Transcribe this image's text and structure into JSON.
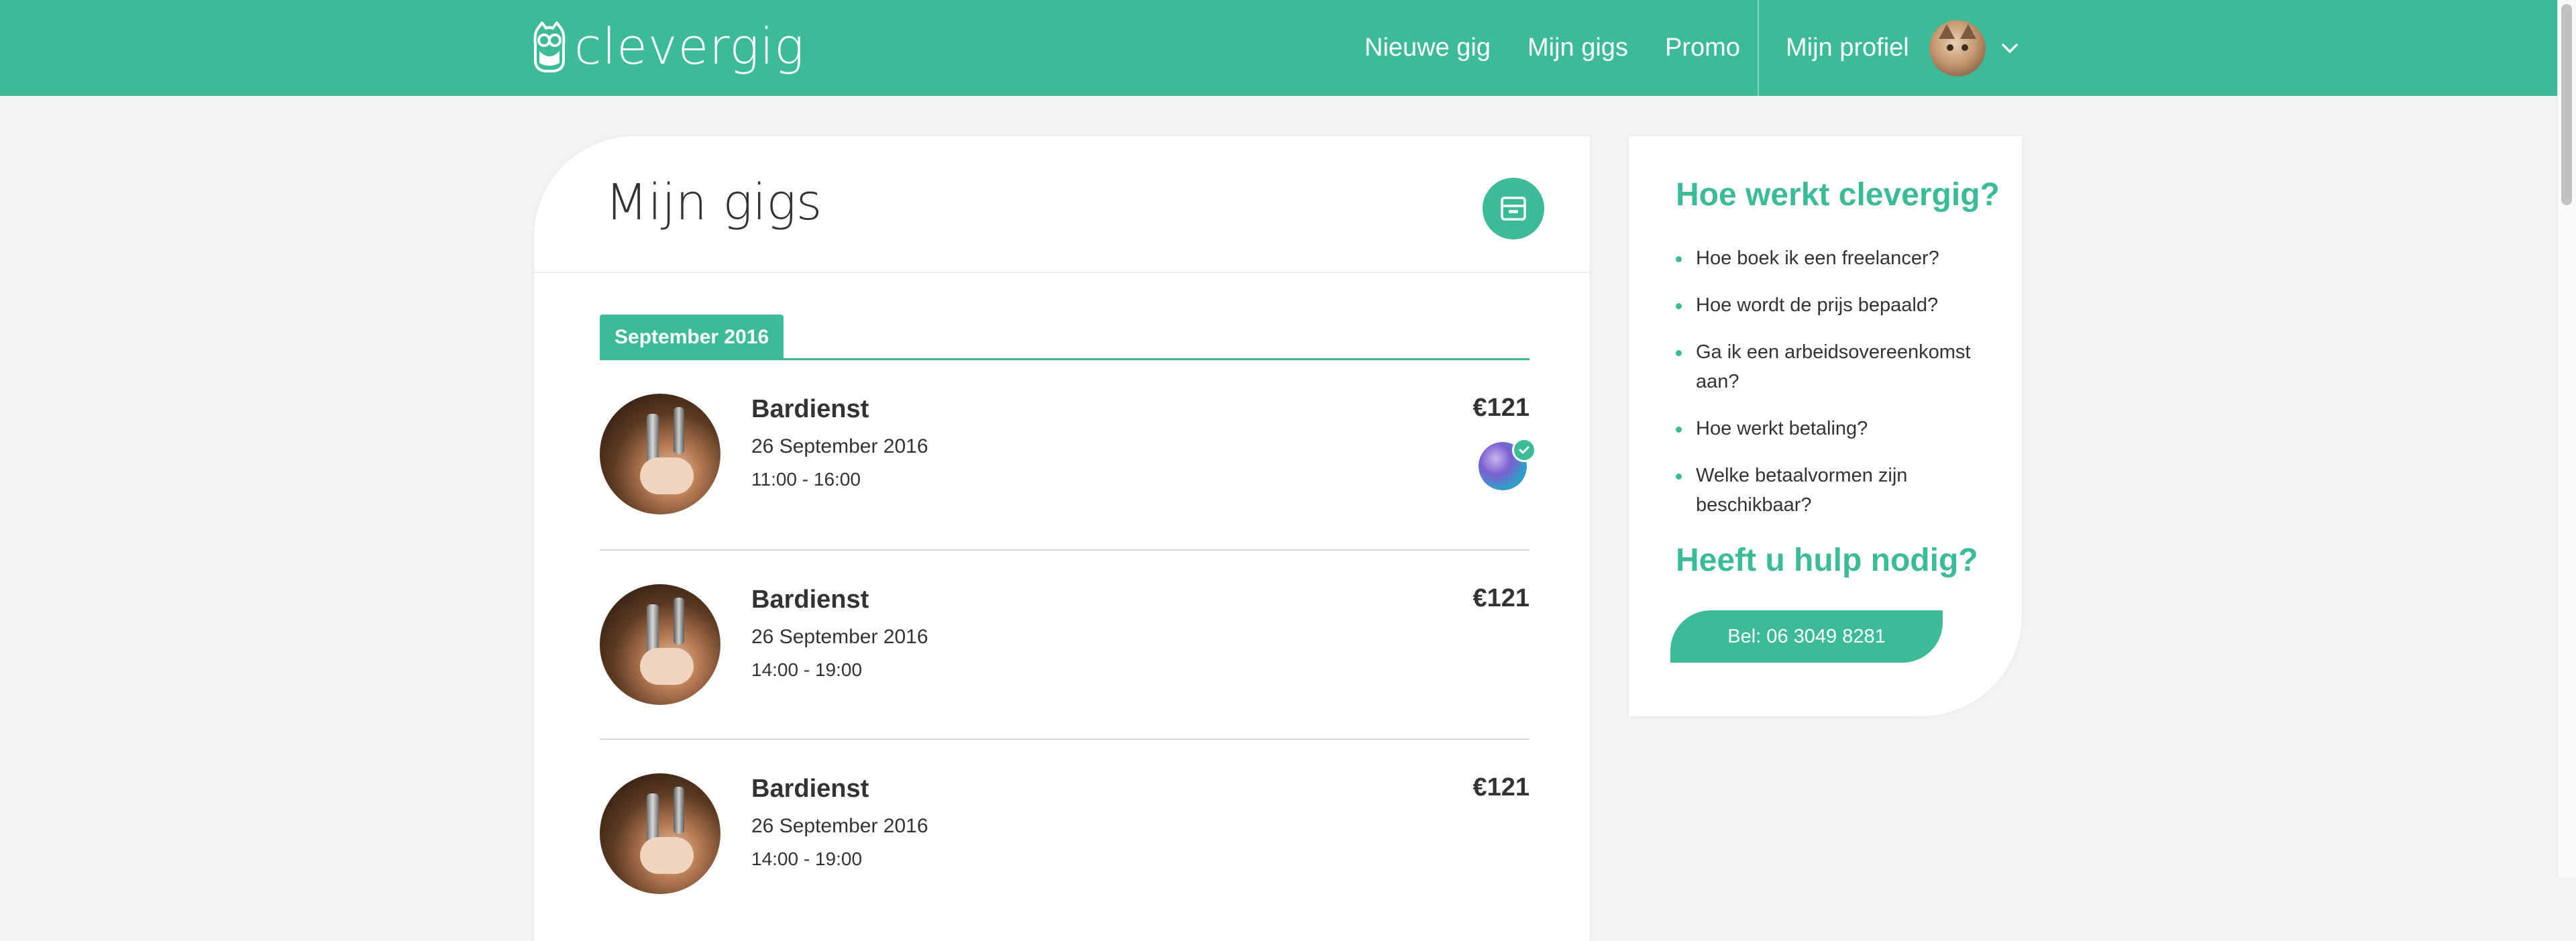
{
  "header": {
    "logo_text": "clevergig",
    "nav": [
      {
        "label": "Nieuwe gig"
      },
      {
        "label": "Mijn gigs"
      },
      {
        "label": "Promo"
      }
    ],
    "profile_label": "Mijn profiel"
  },
  "main": {
    "title": "Mijn gigs",
    "month_tab": "September 2016",
    "gigs": [
      {
        "title": "Bardienst",
        "date": "26 September 2016",
        "time": "11:00 - 16:00",
        "price": "€121",
        "has_freelancer": true
      },
      {
        "title": "Bardienst",
        "date": "26 September 2016",
        "time": "14:00 - 19:00",
        "price": "€121",
        "has_freelancer": false
      },
      {
        "title": "Bardienst",
        "date": "26 September 2016",
        "time": "14:00 - 19:00",
        "price": "€121",
        "has_freelancer": false
      }
    ]
  },
  "sidebar": {
    "title": "Hoe werkt clevergig?",
    "faq": [
      {
        "label": "Hoe boek ik een freelancer?"
      },
      {
        "label": "Hoe wordt de prijs bepaald?"
      },
      {
        "label": "Ga ik een arbeidsovereenkomst aan?"
      },
      {
        "label": "Hoe werkt betaling?"
      },
      {
        "label": "Welke betaalvormen zijn beschikbaar?"
      }
    ],
    "help_title": "Heeft u hulp nodig?",
    "call_button": "Bel: 06 3049 8281"
  },
  "colors": {
    "accent": "#3dbb98",
    "background": "#f3f3f3",
    "text": "#333333"
  },
  "icons": {
    "logo": "owl-logo-icon",
    "archive": "archive-box-icon",
    "dropdown": "chevron-down-icon",
    "verified": "checkmark-icon"
  }
}
